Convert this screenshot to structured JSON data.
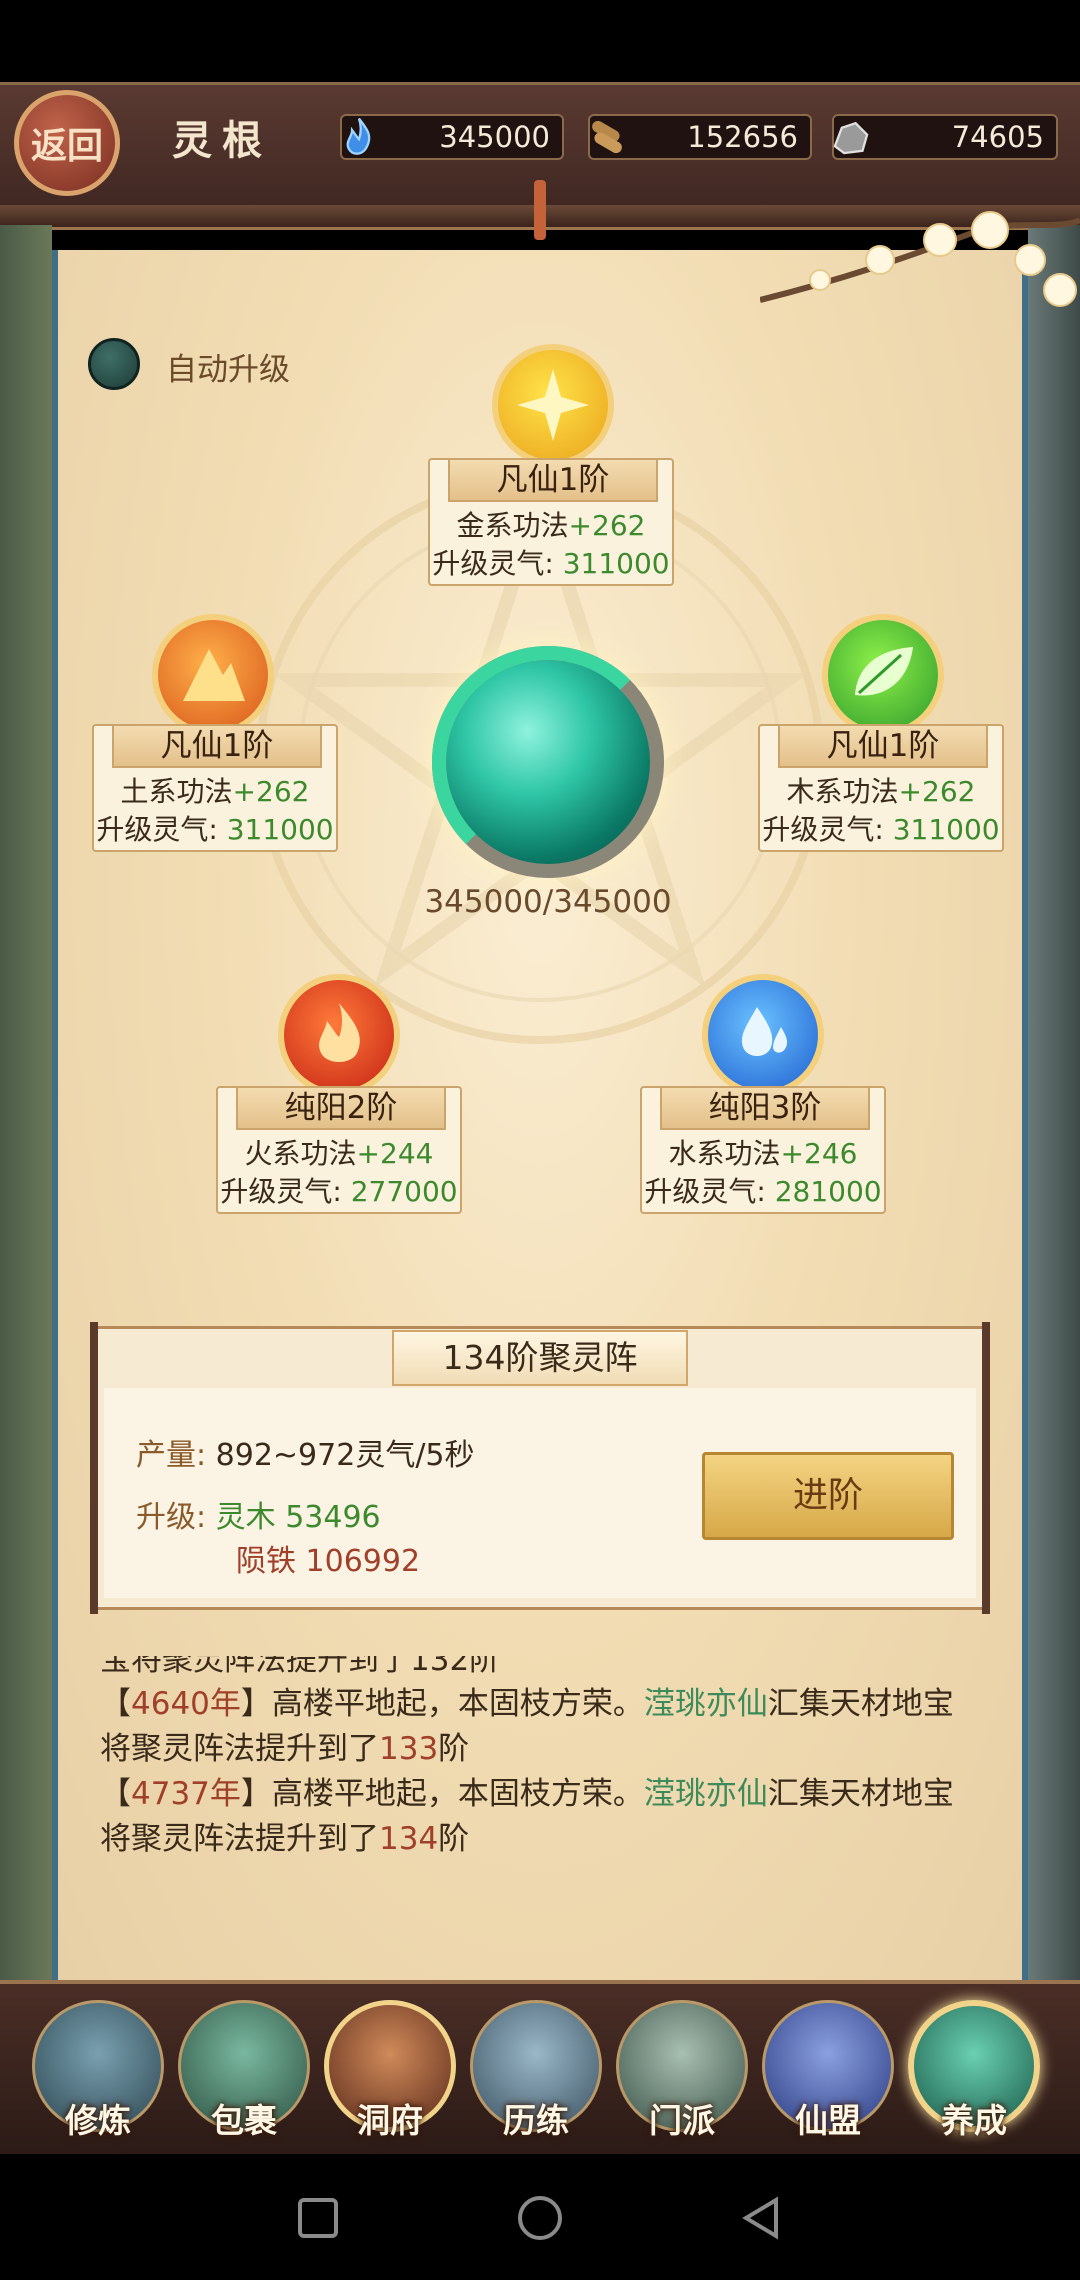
{
  "header": {
    "back_label": "返回",
    "title": "灵根",
    "resources": [
      {
        "icon": "spirit-flame-icon",
        "value": "345000"
      },
      {
        "icon": "wood-log-icon",
        "value": "152656"
      },
      {
        "icon": "iron-ore-icon",
        "value": "74605"
      }
    ]
  },
  "auto_upgrade": {
    "label": "自动升级"
  },
  "center_orb": {
    "value": "345000/345000"
  },
  "elements": {
    "metal": {
      "icon": "metal-sun-icon",
      "title": "凡仙1阶",
      "skill": "金系功法",
      "bonus": "+262",
      "cost_label": "升级灵气:",
      "cost": "311000"
    },
    "wood": {
      "icon": "wood-leaf-icon",
      "title": "凡仙1阶",
      "skill": "木系功法",
      "bonus": "+262",
      "cost_label": "升级灵气:",
      "cost": "311000"
    },
    "earth": {
      "icon": "earth-mountain-icon",
      "title": "凡仙1阶",
      "skill": "土系功法",
      "bonus": "+262",
      "cost_label": "升级灵气:",
      "cost": "311000"
    },
    "fire": {
      "icon": "fire-flame-icon",
      "title": "纯阳2阶",
      "skill": "火系功法",
      "bonus": "+244",
      "cost_label": "升级灵气:",
      "cost": "277000"
    },
    "water": {
      "icon": "water-drop-icon",
      "title": "纯阳3阶",
      "skill": "水系功法",
      "bonus": "+246",
      "cost_label": "升级灵气:",
      "cost": "281000"
    }
  },
  "array": {
    "title": "134阶聚灵阵",
    "production_label": "产量:",
    "production_value": "892~972灵气/5秒",
    "upgrade_label": "升级:",
    "cost_1": "灵木 53496",
    "cost_2": "陨铁 106992",
    "advance_button": "进阶"
  },
  "log": {
    "partial": "宝将聚灵阵法提升到了132阶",
    "entries": [
      {
        "year": "4640年",
        "pre": "】高楼平地起，本固枝方荣。",
        "name": "滢珧亦仙",
        "post": "汇集天材地宝将聚灵阵法提升到了",
        "level": "133",
        "suffix": "阶"
      },
      {
        "year": "4737年",
        "pre": "】高楼平地起，本固枝方荣。",
        "name": "滢珧亦仙",
        "post": "汇集天材地宝将聚灵阵法提升到了",
        "level": "134",
        "suffix": "阶"
      }
    ],
    "open_bracket": "【"
  },
  "nav": [
    {
      "label": "修炼",
      "icon": "cultivator-icon"
    },
    {
      "label": "包裹",
      "icon": "bag-icon"
    },
    {
      "label": "洞府",
      "icon": "cave-palace-icon"
    },
    {
      "label": "历练",
      "icon": "scroll-icon"
    },
    {
      "label": "门派",
      "icon": "sect-gate-icon"
    },
    {
      "label": "仙盟",
      "icon": "alliance-crown-icon"
    },
    {
      "label": "养成",
      "icon": "pentagram-icon"
    }
  ]
}
